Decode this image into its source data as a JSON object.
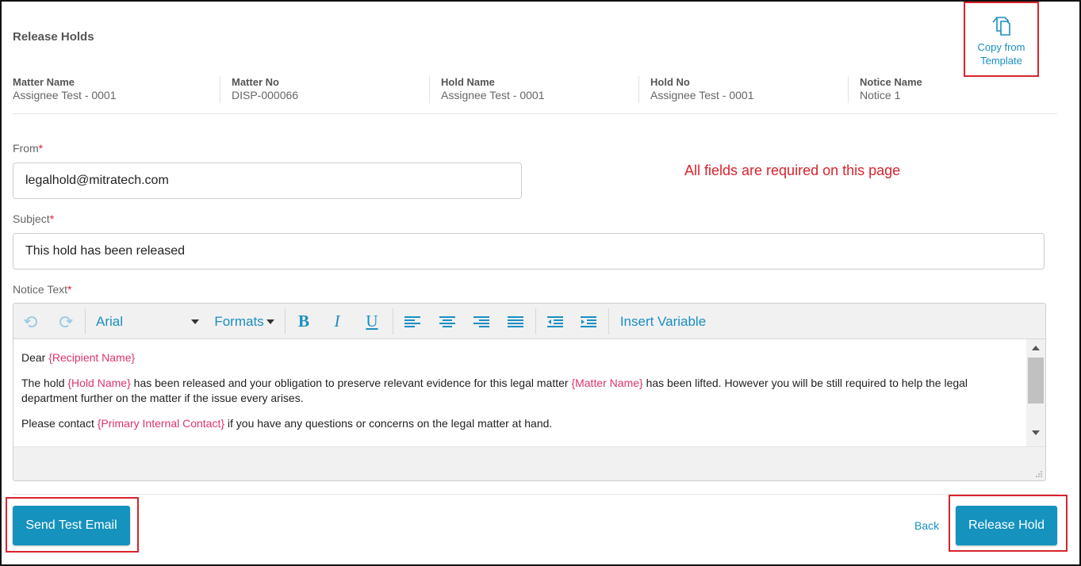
{
  "page": {
    "title": "Release Holds"
  },
  "copy_template": {
    "label_line1": "Copy from",
    "label_line2": "Template",
    "icon": "copy-icon"
  },
  "meta": [
    {
      "key": "Matter Name",
      "value": "Assignee Test - 0001"
    },
    {
      "key": "Matter No",
      "value": "DISP-000066"
    },
    {
      "key": "Hold Name",
      "value": "Assignee Test - 0001"
    },
    {
      "key": "Hold No",
      "value": "Assignee Test - 0001"
    },
    {
      "key": "Notice Name",
      "value": "Notice 1"
    }
  ],
  "form": {
    "from_label": "From",
    "from_value": "legalhold@mitratech.com",
    "subject_label": "Subject",
    "subject_value": "This hold has been released",
    "notice_label": "Notice Text",
    "required_mark": "*",
    "required_note": "All fields are required on this page"
  },
  "toolbar": {
    "font": "Arial",
    "formats": "Formats",
    "insert_variable": "Insert Variable",
    "bold": "B",
    "italic": "I",
    "underline": "U"
  },
  "notice": {
    "p1_a": "Dear ",
    "p1_var": "{Recipient Name}",
    "p2_a": "The hold ",
    "p2_var1": "{Hold Name}",
    "p2_b": " has been released and your obligation to preserve relevant evidence for this legal matter ",
    "p2_var2": "{Matter Name}",
    "p2_c": " has been lifted.  However you will be still required to help the legal department further on the matter if the issue every arises.",
    "p3_a": "Please contact ",
    "p3_var": "{Primary Internal Contact}",
    "p3_b": " if you have any questions or concerns on the legal matter at hand."
  },
  "actions": {
    "send_test": "Send Test Email",
    "back": "Back",
    "release": "Release Hold"
  },
  "colors": {
    "accent": "#1592bd",
    "highlight": "#d9232d",
    "variable": "#e0336e"
  }
}
